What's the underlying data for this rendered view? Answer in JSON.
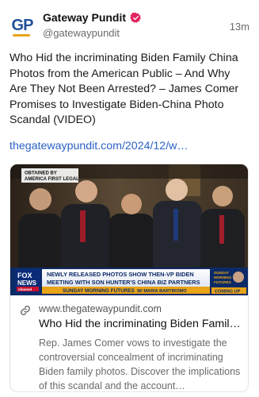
{
  "post": {
    "author": {
      "avatar_initials": "GP",
      "display_name": "Gateway Pundit",
      "handle": "@gatewaypundit",
      "verified_icon": "verified-badge-icon"
    },
    "timestamp": "13m",
    "text": "Who Hid the incriminating Biden Family China Photos from the American Public – And Why Are They Not Been Arrested? – James Comer Promises to Investigate Biden-China Photo Scandal (VIDEO)",
    "link_text": "thegatewaypundit.com/2024/12/w…"
  },
  "card": {
    "image": {
      "watermark": "OBTAINED BY AMERICA FIRST LEGAL",
      "channel_logo_line1": "FOX",
      "channel_logo_line2": "NEWS",
      "channel_logo_line3": "channel",
      "headline_line1": "NEWLY RELEASED PHOTOS SHOW THEN-VP BIDEN",
      "headline_line2": "MEETING WITH SON HUNTER'S CHINA BIZ PARTNERS",
      "show_name": "SUNDAY MORNING FUTURES",
      "host": "W/ MARIA BARTIROMO",
      "side_label_1": "SUNDAY",
      "side_label_2": "MORNING",
      "side_label_3": "FUTURES",
      "coming_up": "COMING UP"
    },
    "domain": "www.thegatewaypundit.com",
    "title": "Who Hid the incriminating Biden Famil…",
    "description": "Rep. James Comer vows to investigate the controversial concealment of incriminating Biden family photos. Discover the implications of this scandal and the account…",
    "link_icon": "link-icon"
  },
  "colors": {
    "link": "#2b62c4",
    "verified": "#e0245e",
    "banner": "#1a3f8f",
    "accent": "#e8a317"
  }
}
